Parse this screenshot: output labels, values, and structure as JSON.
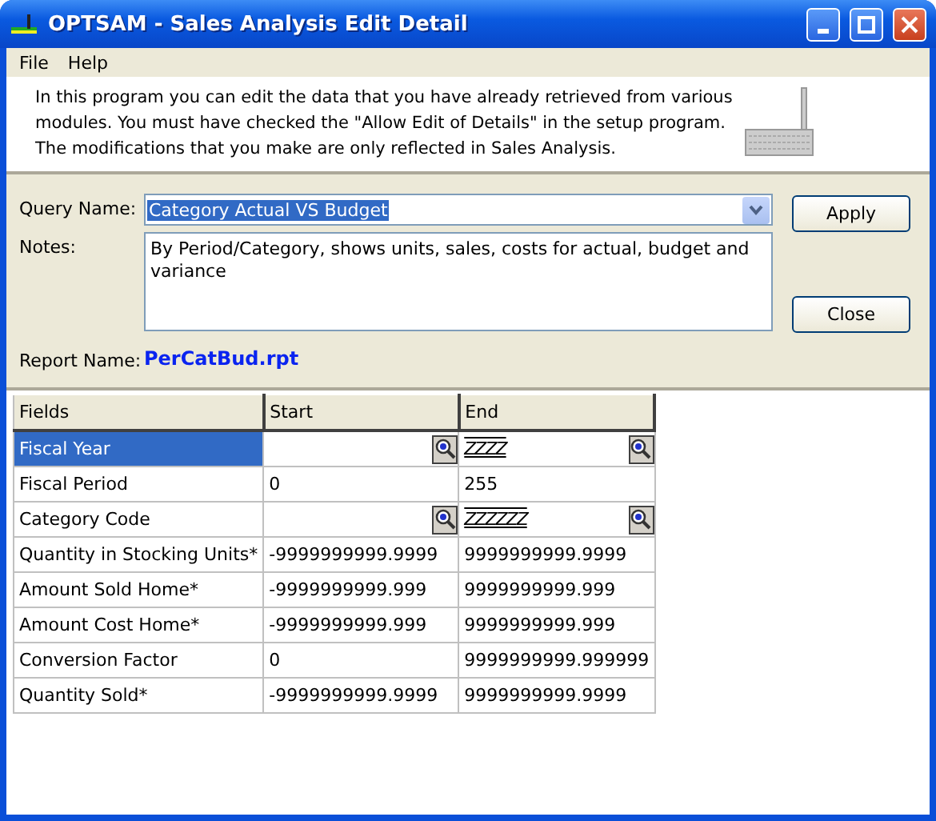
{
  "window": {
    "title": "OPTSAM - Sales Analysis Edit Detail"
  },
  "menu": [
    "File",
    "Help"
  ],
  "info": {
    "text": "In this program you can edit the data that you have already retrieved from various modules. You must have checked the \"Allow Edit of Details\" in the setup program. The modifications that you make are only reflected in Sales Analysis."
  },
  "form": {
    "query_label": "Query Name:",
    "query_value": "Category Actual VS Budget",
    "notes_label": "Notes:",
    "notes": "By Period/Category, shows units, sales, costs for actual, budget and variance",
    "report_label": "Report Name:",
    "report_name": "PerCatBud.rpt"
  },
  "buttons": [
    "Apply",
    "Close"
  ],
  "table": {
    "columns": [
      "Fields",
      "Start",
      "End"
    ],
    "rows": [
      {
        "field": "Fiscal Year",
        "selected": true,
        "start": {
          "lookup": true
        },
        "end": {
          "value": "ZZZZ",
          "kind": "mask",
          "lookup": true
        }
      },
      {
        "field": "Fiscal Period",
        "selected": false,
        "start": {
          "value": "0",
          "lookup": false
        },
        "end": {
          "value": "255",
          "kind": "plain",
          "lookup": false
        }
      },
      {
        "field": "Category Code",
        "selected": false,
        "start": {
          "lookup": true
        },
        "end": {
          "value": "ZZZZZZ",
          "kind": "mask",
          "lookup": true
        }
      },
      {
        "field": "Quantity in Stocking Units*",
        "selected": false,
        "start": {
          "value": "-9999999999.9999",
          "lookup": false
        },
        "end": {
          "value": "9999999999.9999",
          "kind": "plain",
          "lookup": false
        }
      },
      {
        "field": "Amount Sold Home*",
        "selected": false,
        "start": {
          "value": "-9999999999.999",
          "lookup": false
        },
        "end": {
          "value": "9999999999.999",
          "kind": "plain",
          "lookup": false
        }
      },
      {
        "field": "Amount Cost Home*",
        "selected": false,
        "start": {
          "value": "-9999999999.999",
          "lookup": false
        },
        "end": {
          "value": "9999999999.999",
          "kind": "plain",
          "lookup": false
        }
      },
      {
        "field": "Conversion Factor",
        "selected": false,
        "start": {
          "value": "0",
          "lookup": false
        },
        "end": {
          "value": "9999999999.999999",
          "kind": "plain",
          "lookup": false
        }
      },
      {
        "field": "Quantity Sold*",
        "selected": false,
        "start": {
          "value": "-9999999999.9999",
          "lookup": false
        },
        "end": {
          "value": "9999999999.9999",
          "kind": "plain",
          "lookup": false
        }
      }
    ]
  }
}
